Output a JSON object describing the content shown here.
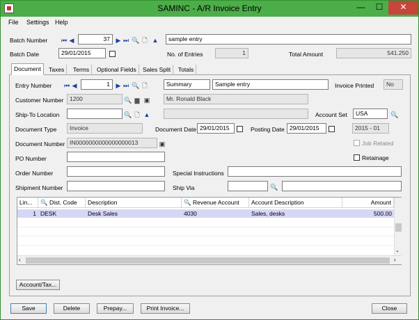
{
  "window": {
    "title": "SAMINC - A/R Invoice Entry",
    "minimize": "—",
    "maximize": "☐",
    "close": "✕"
  },
  "menu": [
    "File",
    "Settings",
    "Help"
  ],
  "batch": {
    "number_label": "Batch Number",
    "number": "37",
    "description": "sample entry",
    "date_label": "Batch Date",
    "date": "29/01/2015",
    "entries_label": "No. of Entries",
    "entries": "1",
    "total_label": "Total Amount",
    "total": "541.250"
  },
  "tabs": [
    "Document",
    "Taxes",
    "Terms",
    "Optional Fields",
    "Sales Split",
    "Totals"
  ],
  "document": {
    "entry_label": "Entry Number",
    "entry": "1",
    "summary_label": "Summary",
    "summary": "Sample entry",
    "printed_label": "Invoice Printed",
    "printed": "No",
    "customer_label": "Customer Number",
    "customer": "1200",
    "customer_name": "Mr. Ronald Black",
    "shipto_label": "Ship-To Location",
    "shipto": "",
    "shipto_desc": "",
    "account_set_label": "Account Set",
    "account_set": "USA",
    "doctype_label": "Document Type",
    "doctype": "Invoice",
    "docdate_label": "Document Date",
    "docdate": "29/01/2015",
    "postdate_label": "Posting Date",
    "postdate": "29/01/2015",
    "period": "2015 - 01",
    "docnum_label": "Document Number",
    "docnum": "IN0000000000000000013",
    "job_related_label": "Job Related",
    "po_label": "PO Number",
    "po": "",
    "retainage_label": "Retainage",
    "order_label": "Order Number",
    "order": "",
    "special_label": "Special Instructions",
    "special": "",
    "shipment_label": "Shipment Number",
    "shipment": "",
    "shipvia_label": "Ship Via",
    "shipvia": "",
    "shipvia_desc": ""
  },
  "grid": {
    "headers": [
      "Lin...",
      "Dist. Code",
      "Description",
      "Revenue Account",
      "Account Description",
      "Amount"
    ],
    "rows": [
      {
        "line": "1",
        "dist": "DESK",
        "desc": "Desk Sales",
        "revenue": "4030",
        "acct_desc": "Sales, desks",
        "amount": "500.00"
      }
    ]
  },
  "buttons": {
    "account_tax": "Account/Tax...",
    "save": "Save",
    "delete": "Delete",
    "prepay": "Prepay...",
    "print_invoice": "Print Invoice...",
    "close": "Close"
  },
  "icons": {
    "first": "first-icon",
    "prev": "prev-icon",
    "next": "next-icon",
    "last": "last-icon",
    "finder": "finder-icon",
    "new": "new-document-icon",
    "zoom": "zoom-icon",
    "drilldown": "drilldown-icon"
  },
  "colors": {
    "titlebar": "#4cae48",
    "selected_row": "#d6d6f5",
    "close_button": "#c7463b"
  }
}
